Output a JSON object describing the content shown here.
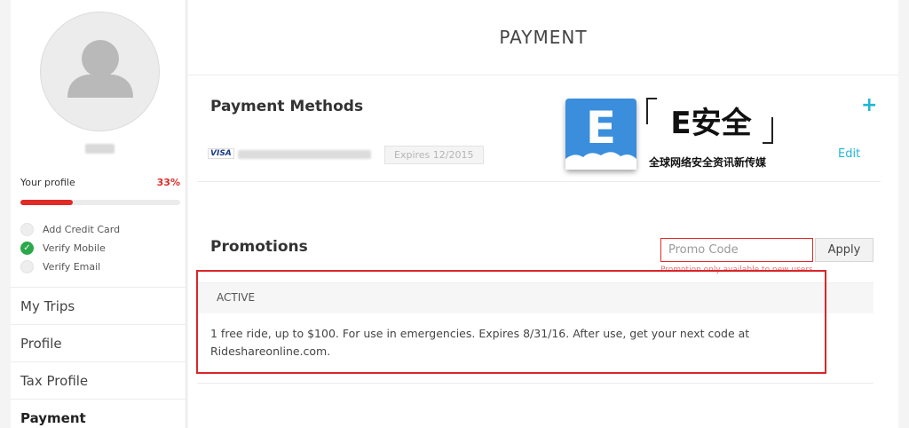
{
  "sidebar": {
    "profile_label": "Your profile",
    "profile_percent": "33%",
    "profile_progress": 0.33,
    "checklist": [
      {
        "label": "Add Credit Card",
        "done": false
      },
      {
        "label": "Verify Mobile",
        "done": true
      },
      {
        "label": "Verify Email",
        "done": false
      }
    ],
    "nav": [
      {
        "label": "My Trips"
      },
      {
        "label": "Profile"
      },
      {
        "label": "Tax Profile"
      },
      {
        "label": "Payment",
        "active": true
      }
    ]
  },
  "main": {
    "title": "PAYMENT",
    "payment_methods": {
      "title": "Payment Methods",
      "add_icon": "+",
      "card": {
        "brand": "VISA",
        "expires": "Expires 12/2015",
        "edit_label": "Edit"
      }
    },
    "promotions": {
      "title": "Promotions",
      "input_placeholder": "Promo Code",
      "apply_label": "Apply",
      "note": "Promotion only available to new users",
      "active_header": "ACTIVE",
      "description": "1 free ride, up to $100. For use in emergencies. Expires 8/31/16. After use, get your next code at Rideshareonline.com."
    }
  },
  "watermark": {
    "letter": "E",
    "brand": "E安全",
    "tagline": "全球网络安全资讯新传媒"
  },
  "colors": {
    "accent": "#1fb6d4",
    "alert": "#e02b27",
    "success": "#2aa84a",
    "logo_blue": "#3b8edb"
  }
}
